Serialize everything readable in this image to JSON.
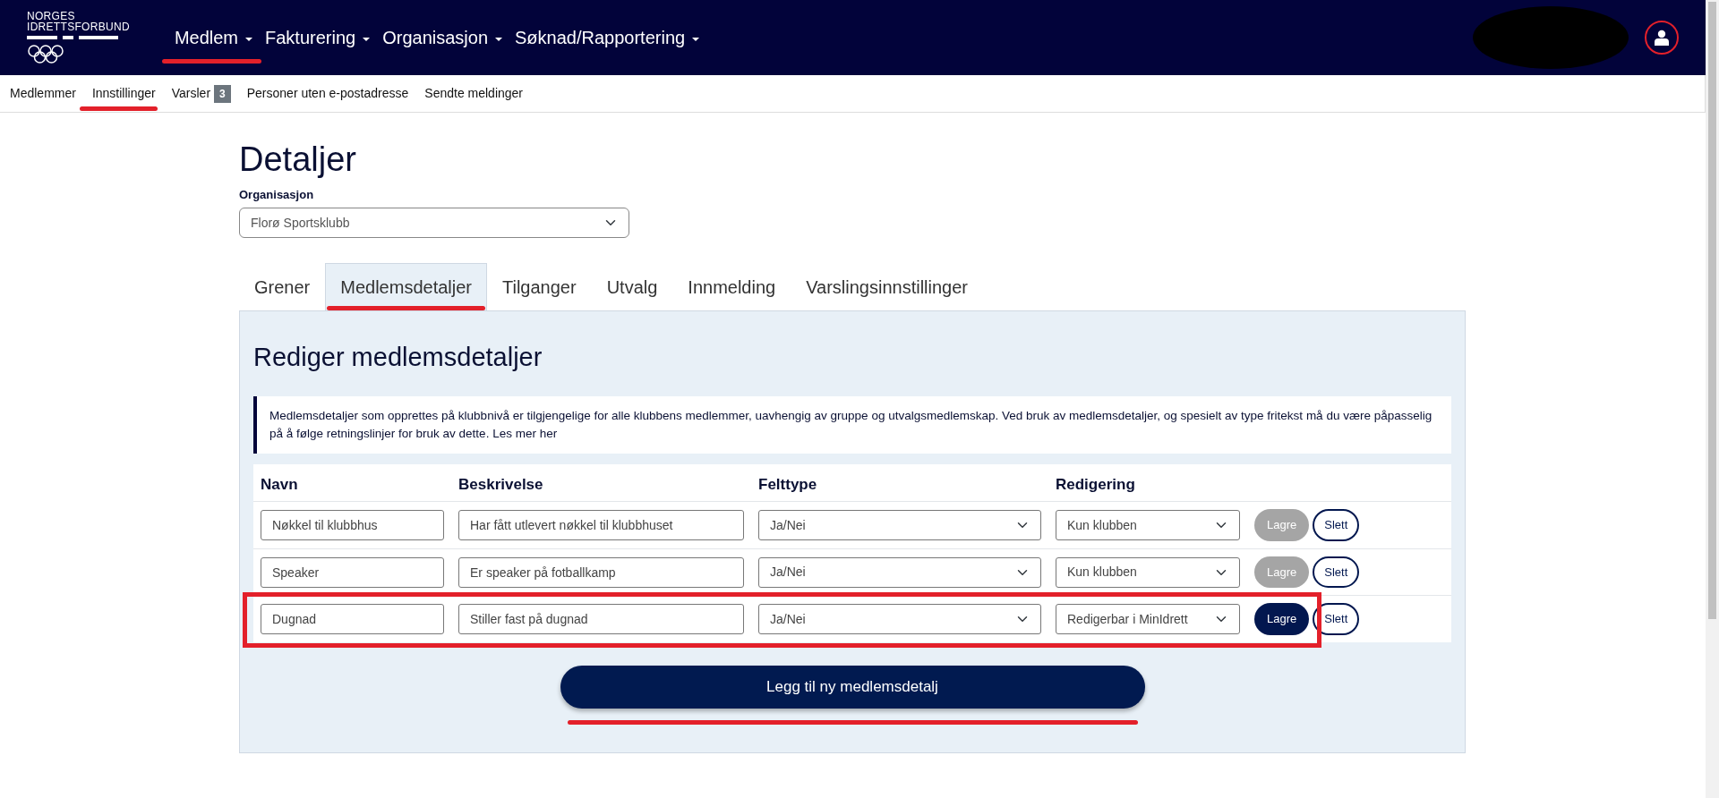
{
  "logo": {
    "line_1": "NORGES",
    "line_2": "IDRETTSFORBUND"
  },
  "main_menu": [
    {
      "label": "Medlem",
      "annotated": true
    },
    {
      "label": "Fakturering",
      "annotated": false
    },
    {
      "label": "Organisasjon",
      "annotated": false
    },
    {
      "label": "Søknad/Rapportering",
      "annotated": false
    }
  ],
  "sub_menu": [
    {
      "label": "Medlemmer",
      "annotated": false
    },
    {
      "label": "Innstillinger",
      "annotated": true
    },
    {
      "label": "Varsler",
      "badge": "3",
      "annotated": false
    },
    {
      "label": "Personer uten e-postadresse",
      "annotated": false
    },
    {
      "label": "Sendte meldinger",
      "annotated": false
    }
  ],
  "page_title": "Detaljer",
  "organization": {
    "label": "Organisasjon",
    "value": "Florø Sportsklubb"
  },
  "tabs": [
    {
      "label": "Grener",
      "selected": false,
      "annotated": false
    },
    {
      "label": "Medlemsdetaljer",
      "selected": true,
      "annotated": true
    },
    {
      "label": "Tilganger",
      "selected": false,
      "annotated": false
    },
    {
      "label": "Utvalg",
      "selected": false,
      "annotated": false
    },
    {
      "label": "Innmelding",
      "selected": false,
      "annotated": false
    },
    {
      "label": "Varslingsinnstillinger",
      "selected": false,
      "annotated": false
    }
  ],
  "panel_title": "Rediger medlemsdetaljer",
  "info_text": "Medlemsdetaljer som opprettes på klubbnivå er tilgjengelige for alle klubbens medlemmer, uavhengig av gruppe og utvalgsmedlemskap. Ved bruk av medlemsdetaljer, og spesielt av type fritekst må du være påpasselig på å følge retningslinjer for bruk av dette. Les mer her",
  "table": {
    "columns": [
      "Navn",
      "Beskrivelse",
      "Felttype",
      "Redigering"
    ],
    "rows": [
      {
        "name": "Nøkkel til klubbhus",
        "description": "Har fått utlevert nøkkel til klubbhuset",
        "field_type": "Ja/Nei",
        "editing": "Kun klubben",
        "save": "Lagre",
        "save_disabled": true,
        "delete": "Slett",
        "annotated": false
      },
      {
        "name": "Speaker",
        "description": "Er speaker på fotballkamp",
        "field_type": "Ja/Nei",
        "editing": "Kun klubben",
        "save": "Lagre",
        "save_disabled": true,
        "delete": "Slett",
        "annotated": false
      },
      {
        "name": "Dugnad",
        "description": "Stiller fast på dugnad",
        "field_type": "Ja/Nei",
        "editing": "Redigerbar i MinIdrett",
        "save": "Lagre",
        "save_disabled": false,
        "delete": "Slett",
        "annotated": true
      }
    ]
  },
  "add_button": {
    "label": "Legg til ny medlemsdetalj",
    "annotated": true
  },
  "user_avatar": {
    "annotated": true
  }
}
